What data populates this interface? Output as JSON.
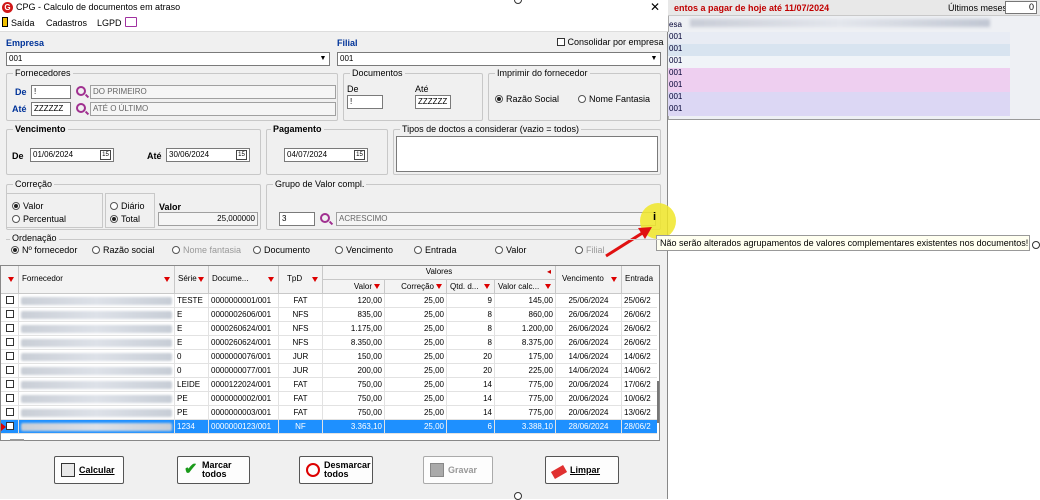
{
  "window": {
    "title": "CPG - Calculo de documentos em atraso",
    "close": "✕",
    "app_icon": "G"
  },
  "menu": {
    "items": [
      "Saída",
      "Cadastros",
      "LGPD"
    ]
  },
  "background_window": {
    "title": "entos a pagar de hoje até 11/07/2024",
    "months_label": "Últimos meses",
    "months_value": "0",
    "col_header": "esa",
    "rows": [
      "001",
      "001",
      "001",
      "001",
      "001",
      "001",
      "001"
    ]
  },
  "empresa": {
    "label": "Empresa",
    "value": "001"
  },
  "filial": {
    "label": "Filial",
    "value": "001"
  },
  "consolidar": {
    "label": "Consolidar por empresa"
  },
  "fornecedores": {
    "label": "Fornecedores",
    "de_label": "De",
    "de_value": "!",
    "de_desc": "DO PRIMEIRO",
    "ate_label": "Até",
    "ate_value": "ZZZZZZ",
    "ate_desc": "ATÉ O ÚLTIMO"
  },
  "documentos": {
    "label": "Documentos",
    "de_label": "De",
    "de_value": "!",
    "ate_label": "Até",
    "ate_value": "ZZZZZZ"
  },
  "imprimir": {
    "label": "Imprimir do fornecedor",
    "opt1": "Razão Social",
    "opt2": "Nome Fantasia"
  },
  "vencimento": {
    "label": "Vencimento",
    "de_label": "De",
    "de_value": "01/06/2024",
    "ate_label": "Até",
    "ate_value": "30/06/2024"
  },
  "pagamento": {
    "label": "Pagamento",
    "value": "04/07/2024"
  },
  "tipos": {
    "label": "Tipos de doctos a considerar (vazio = todos)"
  },
  "correcao": {
    "label": "Correção",
    "valor": "Valor",
    "percentual": "Percentual",
    "diario": "Diário",
    "total": "Total",
    "valor_label": "Valor",
    "valor_value": "25,000000"
  },
  "grupo": {
    "label": "Grupo de Valor compl.",
    "code": "3",
    "desc": "ACRESCIMO",
    "info_icon": "i"
  },
  "tooltip": "Não serão alterados agrupamentos de valores complementares existentes nos documentos!",
  "ordenacao": {
    "label": "Ordenação",
    "options": [
      "Nº fornecedor",
      "Razão social",
      "Nome fantasia",
      "Documento",
      "Vencimento",
      "Entrada",
      "Valor",
      "Filial"
    ]
  },
  "grid": {
    "headers": {
      "fornecedor": "Fornecedor",
      "serie": "Série",
      "documento": "Docume...",
      "tpd": "TpD",
      "valores": "Valores",
      "valor": "Valor",
      "correcao": "Correção",
      "qtd": "Qtd. d...",
      "valor_calc": "Valor calc...",
      "vencimento": "Vencimento",
      "entrada": "Entrada"
    },
    "rows": [
      {
        "serie": "TESTE",
        "doc": "0000000001/001",
        "tpd": "FAT",
        "valor": "120,00",
        "corr": "25,00",
        "qtd": "9",
        "calc": "145,00",
        "venc": "25/06/2024",
        "ent": "25/06/2"
      },
      {
        "serie": "E",
        "doc": "0000002606/001",
        "tpd": "NFS",
        "valor": "835,00",
        "corr": "25,00",
        "qtd": "8",
        "calc": "860,00",
        "venc": "26/06/2024",
        "ent": "26/06/2"
      },
      {
        "serie": "E",
        "doc": "0000260624/001",
        "tpd": "NFS",
        "valor": "1.175,00",
        "corr": "25,00",
        "qtd": "8",
        "calc": "1.200,00",
        "venc": "26/06/2024",
        "ent": "26/06/2"
      },
      {
        "serie": "E",
        "doc": "0000260624/001",
        "tpd": "NFS",
        "valor": "8.350,00",
        "corr": "25,00",
        "qtd": "8",
        "calc": "8.375,00",
        "venc": "26/06/2024",
        "ent": "26/06/2"
      },
      {
        "serie": "0",
        "doc": "0000000076/001",
        "tpd": "JUR",
        "valor": "150,00",
        "corr": "25,00",
        "qtd": "20",
        "calc": "175,00",
        "venc": "14/06/2024",
        "ent": "14/06/2"
      },
      {
        "serie": "0",
        "doc": "0000000077/001",
        "tpd": "JUR",
        "valor": "200,00",
        "corr": "25,00",
        "qtd": "20",
        "calc": "225,00",
        "venc": "14/06/2024",
        "ent": "14/06/2"
      },
      {
        "serie": "LEIDE",
        "doc": "0000122024/001",
        "tpd": "FAT",
        "valor": "750,00",
        "corr": "25,00",
        "qtd": "14",
        "calc": "775,00",
        "venc": "20/06/2024",
        "ent": "17/06/2"
      },
      {
        "serie": "PE",
        "doc": "0000000002/001",
        "tpd": "FAT",
        "valor": "750,00",
        "corr": "25,00",
        "qtd": "14",
        "calc": "775,00",
        "venc": "20/06/2024",
        "ent": "10/06/2"
      },
      {
        "serie": "PE",
        "doc": "0000000003/001",
        "tpd": "FAT",
        "valor": "750,00",
        "corr": "25,00",
        "qtd": "14",
        "calc": "775,00",
        "venc": "20/06/2024",
        "ent": "13/06/2"
      },
      {
        "serie": "1234",
        "doc": "0000000123/001",
        "tpd": "NF",
        "valor": "3.363,10",
        "corr": "25,00",
        "qtd": "6",
        "calc": "3.388,10",
        "venc": "28/06/2024",
        "ent": "28/06/2"
      }
    ]
  },
  "buttons": {
    "calcular": "Calcular",
    "marcar": "Marcar todos",
    "desmarcar": "Desmarcar todos",
    "gravar": "Gravar",
    "limpar": "Limpar"
  },
  "colors": {
    "accent": "#003399",
    "selected": "#1e90ff",
    "bg_title": "#c00000"
  }
}
